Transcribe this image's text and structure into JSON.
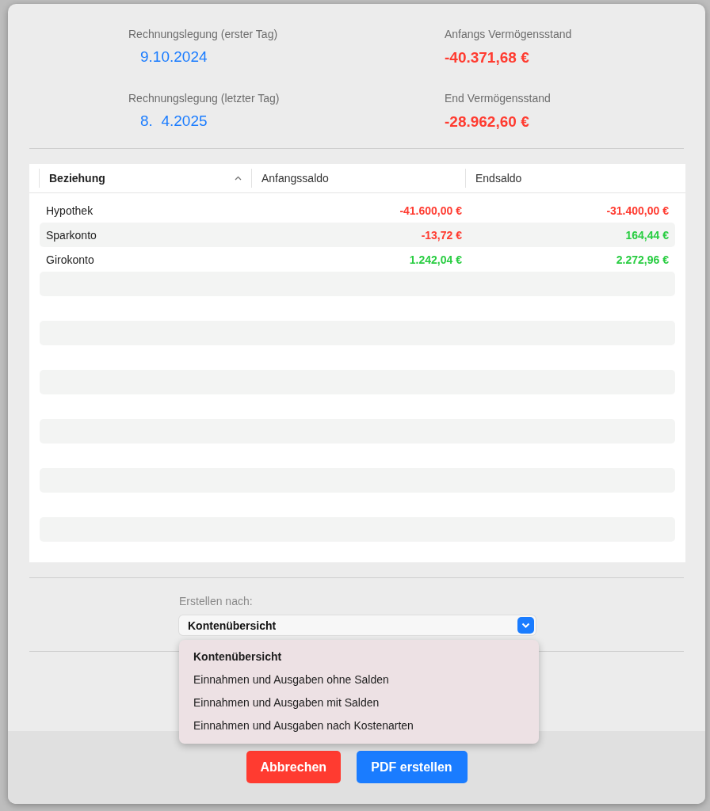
{
  "summary": [
    {
      "label": "Rechnungslegung (erster Tag)",
      "value": "9.10.2024",
      "kind": "date"
    },
    {
      "label": "Anfangs Vermögensstand",
      "value": "-40.371,68 €",
      "kind": "amount"
    },
    {
      "label": "Rechnungslegung (letzter Tag)",
      "value": "8.  4.2025",
      "kind": "date"
    },
    {
      "label": "End Vermögensstand",
      "value": "-28.962,60 €",
      "kind": "amount"
    }
  ],
  "table": {
    "columns": [
      {
        "label": "Beziehung",
        "sorted": true
      },
      {
        "label": "Anfangssaldo",
        "sorted": false
      },
      {
        "label": "Endsaldo",
        "sorted": false
      }
    ],
    "rows": [
      {
        "name": "Hypothek",
        "start": {
          "text": "-41.600,00 €",
          "color": "#ff3b30"
        },
        "end": {
          "text": "-31.400,00 €",
          "color": "#ff3b30"
        }
      },
      {
        "name": "Sparkonto",
        "start": {
          "text": "-13,72 €",
          "color": "#ff3b30"
        },
        "end": {
          "text": "164,44 €",
          "color": "#28cd41"
        }
      },
      {
        "name": "Girokonto",
        "start": {
          "text": "1.242,04 €",
          "color": "#28cd41"
        },
        "end": {
          "text": "2.272,96 €",
          "color": "#28cd41"
        }
      }
    ]
  },
  "create_by": {
    "label": "Erstellen nach:",
    "value": "Kontenübersicht",
    "options": [
      {
        "label": "Kontenübersicht",
        "selected": true
      },
      {
        "label": "Einnahmen und Ausgaben ohne Salden",
        "selected": false
      },
      {
        "label": "Einnahmen und Ausgaben mit Salden",
        "selected": false
      },
      {
        "label": "Einnahmen und Ausgaben nach Kostenarten",
        "selected": false
      }
    ]
  },
  "buttons": [
    {
      "label": "Abbrechen",
      "kind": "cancel"
    },
    {
      "label": "PDF erstellen",
      "kind": "primary"
    }
  ]
}
